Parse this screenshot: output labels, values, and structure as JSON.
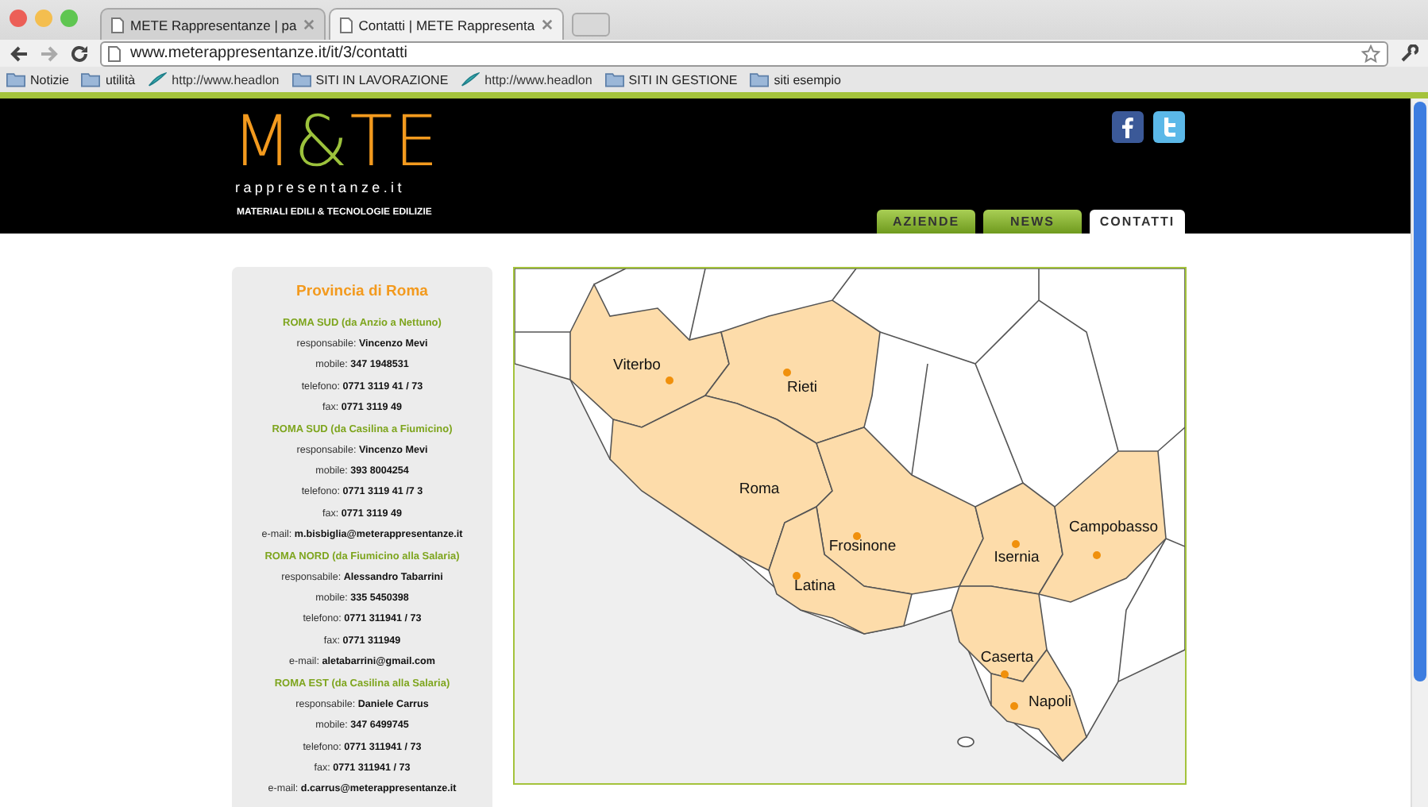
{
  "browser": {
    "tabs": [
      {
        "title": "METE Rappresentanze   |   pa",
        "selected": false
      },
      {
        "title": "Contatti | METE Rappresenta",
        "selected": true
      }
    ],
    "url": "www.meterappresentanze.it/it/3/contatti",
    "bookmarks": [
      {
        "kind": "folder",
        "label": "Notizie"
      },
      {
        "kind": "folder",
        "label": "utilità"
      },
      {
        "kind": "link",
        "label": "http://www.headlon"
      },
      {
        "kind": "folder",
        "label": "SITI IN LAVORAZIONE"
      },
      {
        "kind": "link",
        "label": "http://www.headlon"
      },
      {
        "kind": "folder",
        "label": "SITI IN GESTIONE"
      },
      {
        "kind": "folder",
        "label": "siti esempio"
      }
    ]
  },
  "header": {
    "logo": [
      {
        "text": "M",
        "accent": false
      },
      {
        "text": "&",
        "accent": true
      },
      {
        "text": "TE",
        "accent": false
      }
    ],
    "domain": "rappresentanze.it",
    "tagline": "MATERIALI EDILI & TECNOLOGIE EDILIZIE",
    "nav": [
      {
        "label": "AZIENDE",
        "selected": false
      },
      {
        "label": "NEWS",
        "selected": false
      },
      {
        "label": "CONTATTI",
        "selected": true
      }
    ]
  },
  "sidebar": {
    "title": "Provincia di Roma",
    "sections": [
      {
        "heading": "ROMA SUD (da Anzio a Nettuno)",
        "lines": [
          "responsabile: **Vincenzo Mevi**",
          "mobile: **347 1948531**",
          "telefono: **0771 3119 41 / 73**",
          "fax: **0771 3119 49**"
        ]
      },
      {
        "heading": "ROMA SUD (da Casilina a Fiumicino)",
        "lines": [
          "responsabile: **Vincenzo Mevi**",
          "mobile: **393 8004254**",
          "telefono: **0771 3119 41 /7 3**",
          "fax: **0771 3119 49**",
          "e-mail: **m.bisbiglia@meterappresentanze.it**"
        ]
      },
      {
        "heading": "ROMA NORD (da Fiumicino alla Salaria)",
        "lines": [
          "responsabile: **Alessandro Tabarrini**",
          "mobile: **335 5450398**",
          "telefono: **0771 311941 / 73**",
          "fax: **0771 311949**",
          "e-mail: **aletabarrini@gmail.com**"
        ]
      },
      {
        "heading": "ROMA EST (da Casilina alla Salaria)",
        "lines": [
          "responsabile: **Daniele Carrus**",
          "mobile: **347 6499745**",
          "telefono: **0771 311941 / 73**",
          "fax: **0771 311941 / 73**",
          "e-mail: **d.carrus@meterappresentanze.it**"
        ]
      }
    ]
  },
  "map": {
    "places": [
      {
        "name": "Viterbo",
        "dot": true
      },
      {
        "name": "Rieti",
        "dot": true
      },
      {
        "name": "Roma",
        "dot": false
      },
      {
        "name": "Frosinone",
        "dot": true
      },
      {
        "name": "Latina",
        "dot": true
      },
      {
        "name": "Isernia",
        "dot": true
      },
      {
        "name": "Campobasso",
        "dot": true
      },
      {
        "name": "Caserta",
        "dot": true
      },
      {
        "name": "Napoli",
        "dot": true
      }
    ]
  }
}
